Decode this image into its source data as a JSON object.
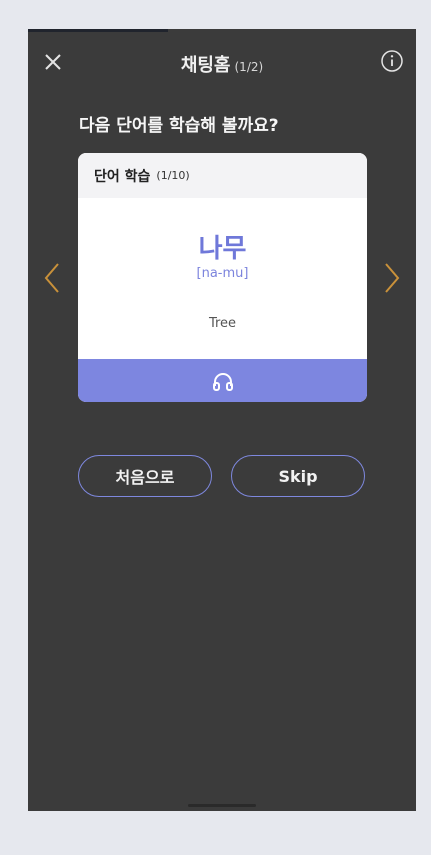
{
  "progress": {
    "fraction": 0.36
  },
  "header": {
    "title": "채팅홈",
    "page_count": "(1/2)"
  },
  "question": "다음 단어를 학습해 볼까요?",
  "card": {
    "section_title": "단어 학습",
    "count": "(1/10)",
    "word": "나무",
    "romanization": "[na-mu]",
    "meaning": "Tree"
  },
  "buttons": {
    "restart": "처음으로",
    "skip": "Skip"
  },
  "icons": {
    "close": "close-icon",
    "info": "info-icon",
    "audio": "headphones-icon",
    "prev": "chevron-left-icon",
    "next": "chevron-right-icon"
  },
  "colors": {
    "background": "#3b3b3b",
    "accent": "#7d86e0",
    "word": "#6f78d9",
    "arrow": "#c9913a"
  }
}
